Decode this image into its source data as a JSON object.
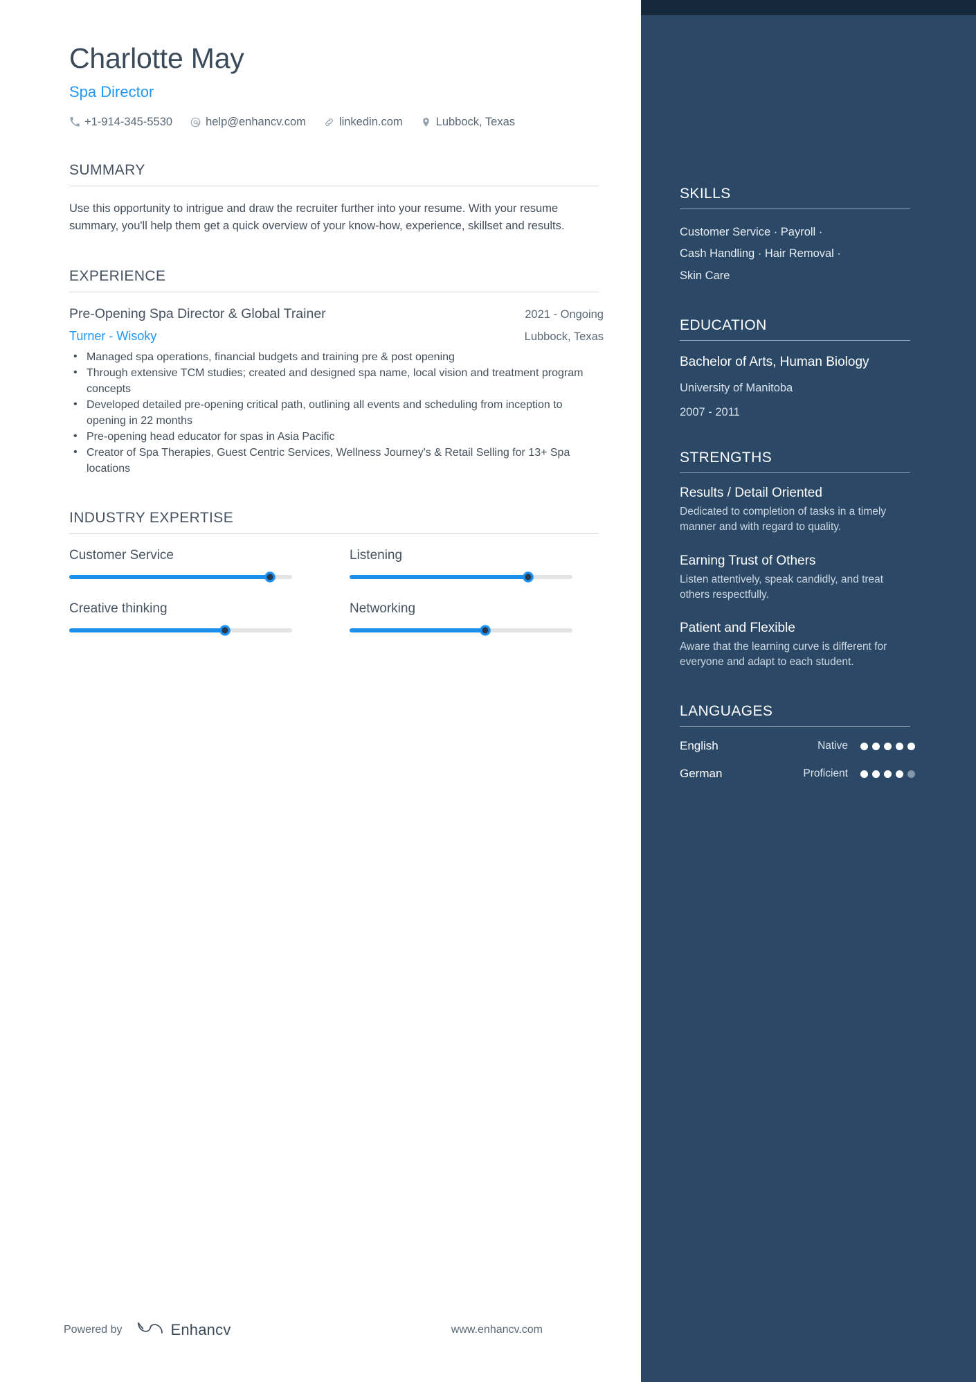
{
  "theme": {
    "sidebar_bg": "#2b4866",
    "sidebar_topbar_bg": "#16283c",
    "accent_blue": "#2196f3",
    "slider_blue": "#1a8fec",
    "heading_gray": "#46525f",
    "body_gray": "#444f5a"
  },
  "header": {
    "name": "Charlotte May",
    "job_title": "Spa Director",
    "contacts": [
      {
        "icon": "phone-icon",
        "text": "+1-914-345-5530"
      },
      {
        "icon": "email-icon",
        "text": "help@enhancv.com"
      },
      {
        "icon": "link-icon",
        "text": "linkedin.com"
      },
      {
        "icon": "location-pin-icon",
        "text": "Lubbock, Texas"
      }
    ]
  },
  "summary": {
    "heading": "SUMMARY",
    "text": "Use this opportunity to intrigue and draw the recruiter further into your resume. With your resume summary, you'll help them get a quick overview of your know-how, experience, skillset and results."
  },
  "experience": {
    "heading": "EXPERIENCE",
    "jobs": [
      {
        "role": "Pre-Opening Spa Director & Global Trainer",
        "dates": "2021 - Ongoing",
        "company": "Turner - Wisoky",
        "location": "Lubbock, Texas",
        "bullets": [
          "Managed spa operations, financial budgets and training pre & post opening",
          "Through extensive TCM studies; created and designed spa name, local vision and treatment program concepts",
          "Developed detailed pre-opening critical path, outlining all events and scheduling from inception to opening in 22 months",
          "Pre-opening head educator for spas  in Asia Pacific",
          "Creator of Spa Therapies, Guest Centric Services, Wellness Journey's & Retail Selling for 13+ Spa locations"
        ]
      }
    ]
  },
  "industry_expertise": {
    "heading": "INDUSTRY EXPERTISE",
    "items": [
      {
        "label": "Customer Service",
        "value": 90
      },
      {
        "label": "Listening",
        "value": 80
      },
      {
        "label": "Creative thinking",
        "value": 70
      },
      {
        "label": "Networking",
        "value": 61
      }
    ]
  },
  "sidebar": {
    "skills": {
      "heading": "SKILLS",
      "lines": [
        "Customer Service · Payroll ·",
        "Cash Handling · Hair Removal ·",
        "Skin Care"
      ]
    },
    "education": {
      "heading": "EDUCATION",
      "degree": "Bachelor of Arts, Human Biology",
      "school": "University of Manitoba",
      "dates": "2007 - 2011"
    },
    "strengths": {
      "heading": "STRENGTHS",
      "items": [
        {
          "title": "Results / Detail Oriented",
          "desc": "Dedicated to completion of tasks in a timely manner and with regard to quality."
        },
        {
          "title": "Earning Trust of Others",
          "desc": "Listen attentively, speak candidly, and treat others respectfully."
        },
        {
          "title": "Patient and Flexible",
          "desc": "Aware that the learning curve is different for everyone and adapt to each student."
        }
      ]
    },
    "languages": {
      "heading": "LANGUAGES",
      "items": [
        {
          "name": "English",
          "level": "Native",
          "filled": 5,
          "total": 5
        },
        {
          "name": "German",
          "level": "Proficient",
          "filled": 4,
          "total": 5
        }
      ]
    }
  },
  "footer": {
    "powered_by": "Powered by",
    "brand": "Enhancv",
    "url": "www.enhancv.com"
  }
}
